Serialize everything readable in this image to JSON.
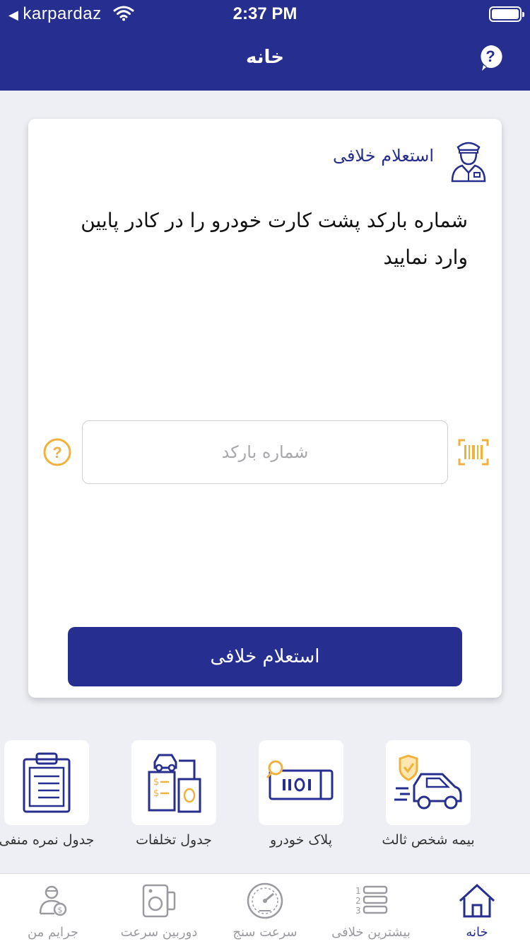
{
  "status_bar": {
    "back_app": "karpardaz",
    "time": "2:37 PM"
  },
  "nav": {
    "title": "خانه",
    "help_icon": "question-circle-icon"
  },
  "card": {
    "title": "استعلام خلافی",
    "instruction": "شماره بارکد پشت کارت خودرو را در کادر پایین وارد نمایید",
    "barcode_placeholder": "شماره بارکد",
    "barcode_value": "",
    "submit_label": "استعلام خلافی"
  },
  "shortcuts": [
    {
      "label": "بیمه شخص ثالث",
      "icon": "insurance-car-icon"
    },
    {
      "label": "پلاک خودرو",
      "icon": "license-plate-icon"
    },
    {
      "label": "جدول تخلفات",
      "icon": "violations-table-icon"
    },
    {
      "label": "جدول نمره منفی",
      "icon": "clipboard-icon"
    }
  ],
  "tabs": [
    {
      "label": "خانه",
      "icon": "home-icon",
      "active": true
    },
    {
      "label": "بیشترین خلافی",
      "icon": "ranking-list-icon",
      "active": false
    },
    {
      "label": "سرعت سنج",
      "icon": "speedometer-icon",
      "active": false
    },
    {
      "label": "دوربین سرعت",
      "icon": "speed-camera-icon",
      "active": false
    },
    {
      "label": "جرایم من",
      "icon": "user-fines-icon",
      "active": false
    }
  ],
  "colors": {
    "primary": "#262f8f",
    "accent": "#f0b23c",
    "background": "#eeeff4",
    "inactive": "#9a9aa0"
  }
}
